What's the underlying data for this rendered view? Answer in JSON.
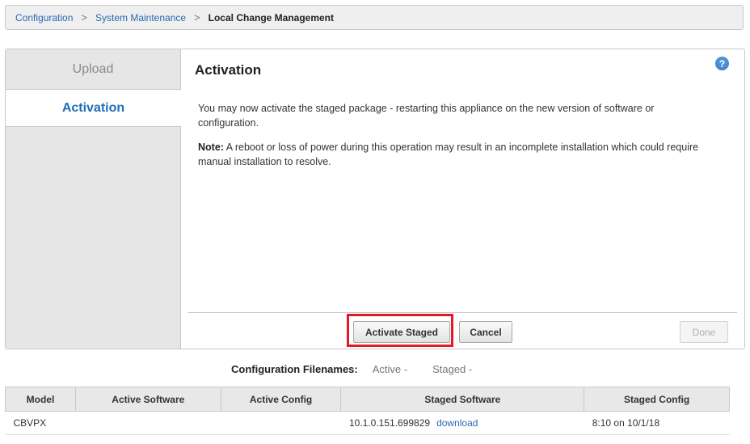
{
  "breadcrumb": {
    "items": [
      "Configuration",
      "System Maintenance"
    ],
    "current": "Local Change Management",
    "separator": ">"
  },
  "sidebar": {
    "tabs": [
      {
        "label": "Upload",
        "active": false
      },
      {
        "label": "Activation",
        "active": true
      }
    ]
  },
  "main": {
    "title": "Activation",
    "help_icon": "?",
    "message": "You may now activate the staged package - restarting this appliance on the new version of software or configuration.",
    "note_label": "Note:",
    "note_text": " A reboot or loss of power during this operation may result in an incomplete installation which could require manual installation to resolve."
  },
  "buttons": {
    "activate": "Activate Staged",
    "cancel": "Cancel",
    "done": "Done"
  },
  "config_filenames": {
    "label": "Configuration Filenames:",
    "active": "Active -",
    "staged": "Staged -"
  },
  "table": {
    "columns": [
      "Model",
      "Active Software",
      "Active Config",
      "Staged Software",
      "Staged Config"
    ],
    "rows": [
      {
        "model": "CBVPX",
        "active_software": "",
        "active_config": "",
        "staged_software": "10.1.0.151.699829",
        "staged_software_link": "download",
        "staged_config": "8:10 on 10/1/18"
      }
    ]
  },
  "colors": {
    "accent": "#1f6fb5",
    "link": "#2a68b0",
    "highlight": "#e01b24"
  }
}
